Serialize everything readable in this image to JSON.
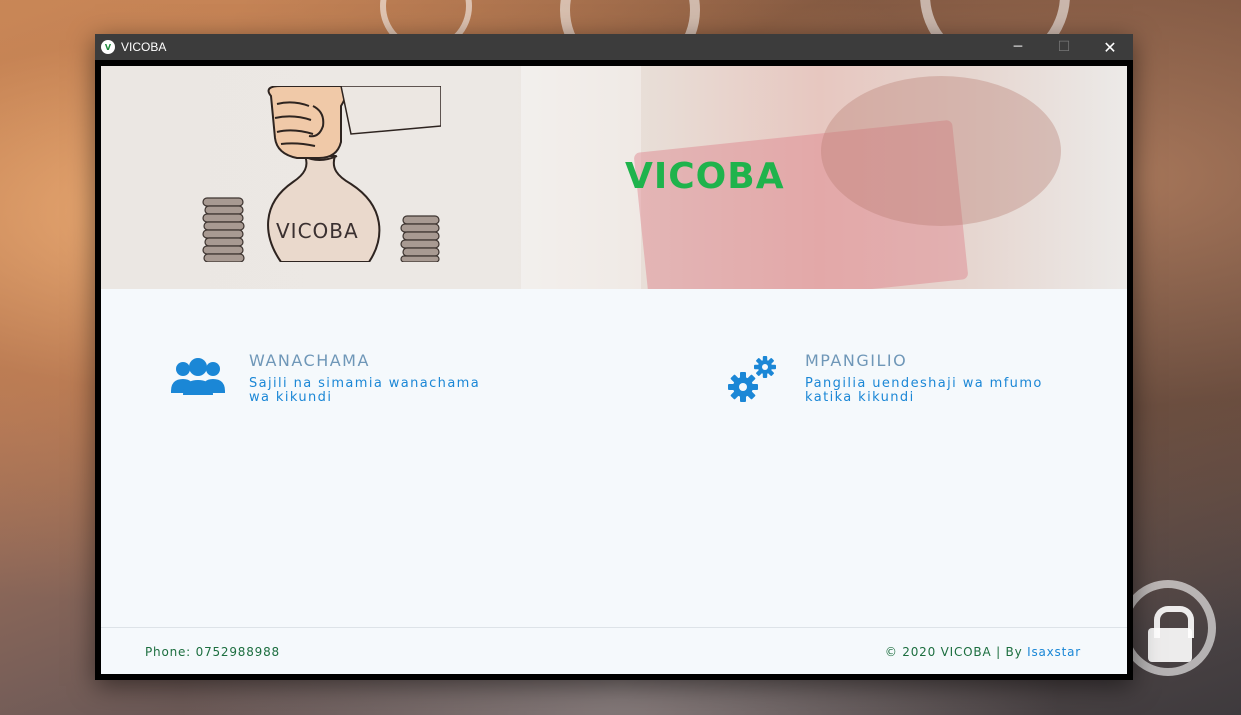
{
  "window": {
    "title": "VICOBA",
    "app_icon_text": "V",
    "minimize_glyph": "─",
    "maximize_glyph": "☐",
    "close_glyph": "✕"
  },
  "banner": {
    "logo_text": "VICOBA",
    "bag_text": "VICOBA",
    "logo_color": "#1fb34c"
  },
  "cards": [
    {
      "title": "WANACHAMA",
      "description": "Sajili na simamia wanachama wa kikundi",
      "icon": "users-group-icon"
    },
    {
      "title": "MPANGILIO",
      "description": "Pangilia uendeshaji wa mfumo katika kikundi",
      "icon": "gears-icon"
    }
  ],
  "footer": {
    "phone": "Phone: 0752988988",
    "copyright": "© 2020 VICOBA | By",
    "author": "Isaxstar"
  },
  "colors": {
    "accent": "#1b87d6",
    "card_title": "#6f97b8",
    "footer_text": "#1c6e3f",
    "titlebar": "#3c3c3c"
  }
}
